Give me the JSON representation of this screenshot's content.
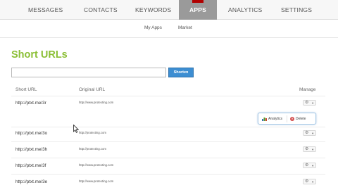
{
  "topnav": {
    "items": [
      {
        "label": "MESSAGES"
      },
      {
        "label": "CONTACTS"
      },
      {
        "label": "KEYWORDS"
      },
      {
        "label": "APPS",
        "active": true
      },
      {
        "label": "ANALYTICS"
      },
      {
        "label": "SETTINGS"
      }
    ]
  },
  "subnav": {
    "items": [
      {
        "label": "My Apps"
      },
      {
        "label": "Market"
      }
    ]
  },
  "page": {
    "title": "Short URLs"
  },
  "shortener": {
    "input_value": "",
    "button_label": "Shorten"
  },
  "table": {
    "headers": {
      "short_url": "Short URL",
      "original_url": "Original URL",
      "manage": "Manage"
    },
    "rows": [
      {
        "short": "http://ptxt.me/3r",
        "original": "http://www.protexting.com"
      },
      {
        "short": "http://ptxt.me/3o",
        "original": "http://protexting.com"
      },
      {
        "short": "http://ptxt.me/3h",
        "original": "http://protexting.com"
      },
      {
        "short": "http://ptxt.me/3f",
        "original": "http://www.protexting.com"
      },
      {
        "short": "http://ptxt.me/3e",
        "original": "http://www.protexting.com"
      }
    ]
  },
  "popover": {
    "analytics_label": "Analytics",
    "delete_label": "Delete"
  },
  "colors": {
    "accent_green": "#8bbf36",
    "button_blue": "#3d8ed2",
    "active_tab_gray": "#9a9a9a",
    "notch_red": "#b00000"
  }
}
